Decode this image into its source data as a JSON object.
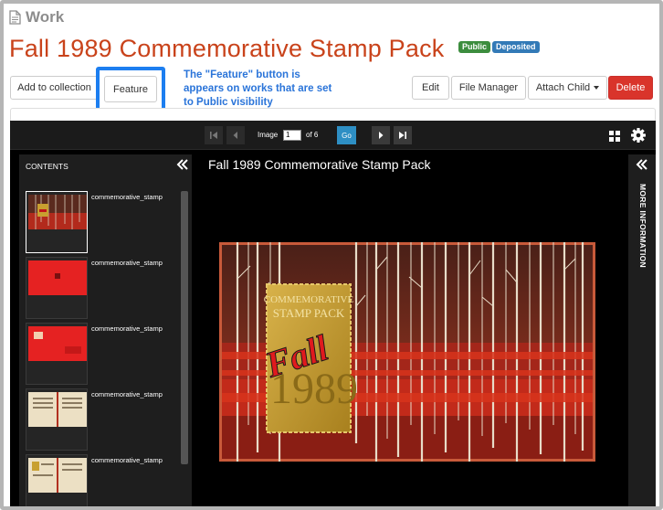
{
  "work_label": "Work",
  "title": "Fall 1989 Commemorative Stamp Pack",
  "badges": {
    "public": "Public",
    "deposited": "Deposited"
  },
  "actions": {
    "add_to_collection": "Add to collection",
    "feature": "Feature",
    "edit": "Edit",
    "file_manager": "File Manager",
    "attach_child": "Attach Child",
    "delete": "Delete"
  },
  "annotation": "The \"Feature\" button is appears on works that are set to Public visibility",
  "viewer": {
    "image_label": "Image",
    "page_value": "1",
    "of_label": "of 6",
    "go_label": "Go",
    "contents_label": "CONTENTS",
    "more_info_label": "MORE INFORMATION",
    "main_title": "Fall 1989 Commemorative Stamp Pack",
    "thumbnails": [
      {
        "label": "commemorative_stamp"
      },
      {
        "label": "commemorative_stamp"
      },
      {
        "label": "commemorative_stamp"
      },
      {
        "label": "commemorative_stamp"
      },
      {
        "label": "commemorative_stamp"
      }
    ],
    "cover_text": {
      "commemorative": "COMMEMORATIVE",
      "stamp_pack": "STAMP PACK",
      "fall": "Fall",
      "year": "1989"
    }
  },
  "colors": {
    "title": "#c9431b",
    "public_badge": "#3c8d3e",
    "deposited_badge": "#337ab7",
    "delete": "#d9342b",
    "annotation": "#2a74d9",
    "go": "#2e8fc4"
  }
}
